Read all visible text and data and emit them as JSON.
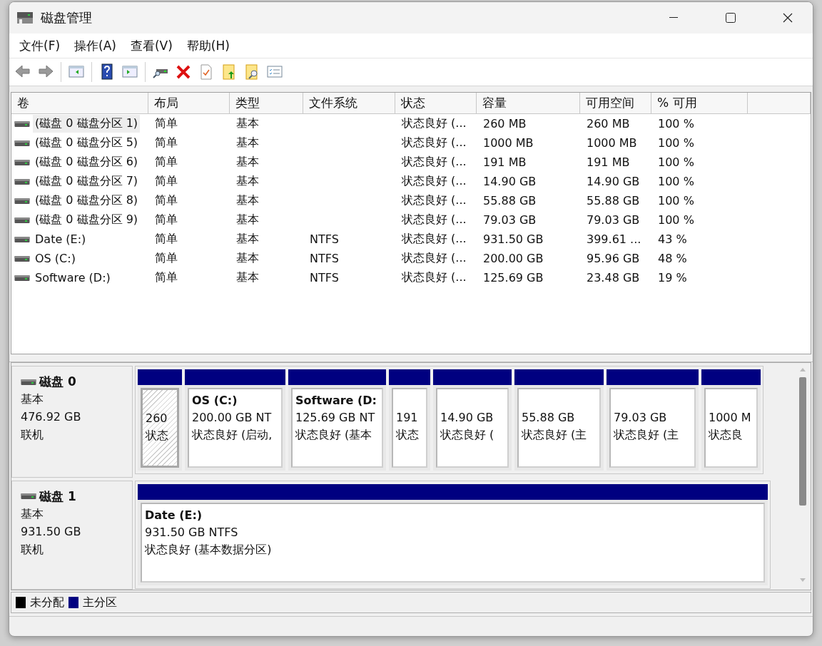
{
  "window": {
    "title": "磁盘管理"
  },
  "menu": [
    {
      "label": "文件(F)"
    },
    {
      "label": "操作(A)"
    },
    {
      "label": "查看(V)"
    },
    {
      "label": "帮助(H)"
    }
  ],
  "volume_list": {
    "columns": [
      "卷",
      "布局",
      "类型",
      "文件系统",
      "状态",
      "容量",
      "可用空间",
      "% 可用"
    ],
    "rows": [
      {
        "volume": "(磁盘 0 磁盘分区 1)",
        "layout": "简单",
        "type": "基本",
        "file_system": "",
        "status": "状态良好 (...",
        "capacity": "260 MB",
        "free_space": "260 MB",
        "percent_free": "100 %",
        "selected": true
      },
      {
        "volume": "(磁盘 0 磁盘分区 5)",
        "layout": "简单",
        "type": "基本",
        "file_system": "",
        "status": "状态良好 (...",
        "capacity": "1000 MB",
        "free_space": "1000 MB",
        "percent_free": "100 %",
        "selected": false
      },
      {
        "volume": "(磁盘 0 磁盘分区 6)",
        "layout": "简单",
        "type": "基本",
        "file_system": "",
        "status": "状态良好 (...",
        "capacity": "191 MB",
        "free_space": "191 MB",
        "percent_free": "100 %",
        "selected": false
      },
      {
        "volume": "(磁盘 0 磁盘分区 7)",
        "layout": "简单",
        "type": "基本",
        "file_system": "",
        "status": "状态良好 (...",
        "capacity": "14.90 GB",
        "free_space": "14.90 GB",
        "percent_free": "100 %",
        "selected": false
      },
      {
        "volume": "(磁盘 0 磁盘分区 8)",
        "layout": "简单",
        "type": "基本",
        "file_system": "",
        "status": "状态良好 (...",
        "capacity": "55.88 GB",
        "free_space": "55.88 GB",
        "percent_free": "100 %",
        "selected": false
      },
      {
        "volume": "(磁盘 0 磁盘分区 9)",
        "layout": "简单",
        "type": "基本",
        "file_system": "",
        "status": "状态良好 (...",
        "capacity": "79.03 GB",
        "free_space": "79.03 GB",
        "percent_free": "100 %",
        "selected": false
      },
      {
        "volume": "Date (E:)",
        "layout": "简单",
        "type": "基本",
        "file_system": "NTFS",
        "status": "状态良好 (...",
        "capacity": "931.50 GB",
        "free_space": "399.61 ...",
        "percent_free": "43 %",
        "selected": false
      },
      {
        "volume": "OS (C:)",
        "layout": "简单",
        "type": "基本",
        "file_system": "NTFS",
        "status": "状态良好 (...",
        "capacity": "200.00 GB",
        "free_space": "95.96 GB",
        "percent_free": "48 %",
        "selected": false
      },
      {
        "volume": "Software (D:)",
        "layout": "简单",
        "type": "基本",
        "file_system": "NTFS",
        "status": "状态良好 (...",
        "capacity": "125.69 GB",
        "free_space": "23.48 GB",
        "percent_free": "19 %",
        "selected": false
      }
    ]
  },
  "disks": [
    {
      "name": "磁盘 0",
      "type": "基本",
      "size": "476.92 GB",
      "state": "联机",
      "partitions": [
        {
          "size": "260",
          "status": "状态",
          "selected": true
        },
        {
          "name": "OS  (C:)",
          "size": "200.00 GB NT",
          "status": "状态良好 (启动,",
          "selected": false
        },
        {
          "name": "Software  (D:",
          "size": "125.69 GB NT",
          "status": "状态良好 (基本",
          "selected": false
        },
        {
          "size": "191",
          "status": "状态",
          "selected": false
        },
        {
          "size": "14.90 GB",
          "status": "状态良好 (",
          "selected": false
        },
        {
          "size": "55.88 GB",
          "status": "状态良好 (主",
          "selected": false
        },
        {
          "size": "79.03 GB",
          "status": "状态良好 (主",
          "selected": false
        },
        {
          "size": "1000 M",
          "status": "状态良",
          "selected": false
        }
      ]
    },
    {
      "name": "磁盘 1",
      "type": "基本",
      "size": "931.50 GB",
      "state": "联机",
      "partitions": [
        {
          "name": "Date  (E:)",
          "size": "931.50 GB NTFS",
          "status": "状态良好 (基本数据分区)",
          "selected": false
        }
      ]
    }
  ],
  "legend": [
    {
      "label": "未分配",
      "color": "#000000"
    },
    {
      "label": "主分区",
      "color": "#000080"
    }
  ]
}
